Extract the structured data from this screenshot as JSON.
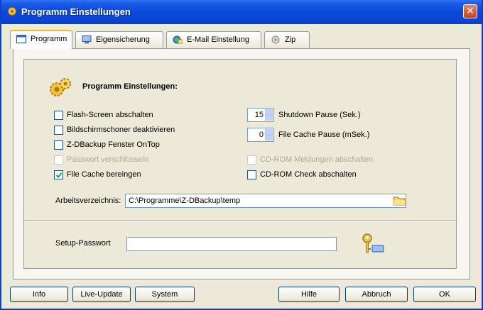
{
  "window": {
    "title": "Programm Einstellungen",
    "close_symbol": "✕"
  },
  "tabs": [
    {
      "label": "Programm",
      "icon": "window-icon"
    },
    {
      "label": "Eigensicherung",
      "icon": "monitor-icon"
    },
    {
      "label": "E-Mail Einstellung",
      "icon": "globe-mail-icon"
    },
    {
      "label": "Zip",
      "icon": "zip-icon"
    }
  ],
  "section": {
    "title": "Programm Einstellungen:"
  },
  "checkboxes_left": [
    {
      "label": "Flash-Screen abschalten",
      "checked": false,
      "enabled": true
    },
    {
      "label": "Bildschirmschoner deaktivieren",
      "checked": false,
      "enabled": true
    },
    {
      "label": "Z-DBackup Fenster OnTop",
      "checked": false,
      "enabled": true
    },
    {
      "label": "Passwort verschlüsseln",
      "checked": false,
      "enabled": false
    },
    {
      "label": "File Cache bereingen",
      "checked": true,
      "enabled": true
    }
  ],
  "spinners": [
    {
      "value": "15",
      "label": "Shutdown Pause (Sek.)"
    },
    {
      "value": "0",
      "label": "File Cache Pause (mSek.)"
    }
  ],
  "checkboxes_right": [
    {
      "label": "CD-ROM Meldungen abschalten",
      "checked": false,
      "enabled": false
    },
    {
      "label": "CD-ROM Check abschalten",
      "checked": false,
      "enabled": true
    }
  ],
  "workdir": {
    "label": "Arbeitsverzeichnis:",
    "value": "C:\\Programme\\Z-DBackup\\temp"
  },
  "password": {
    "label": "Setup-Passwort",
    "value": ""
  },
  "buttons": {
    "info": "Info",
    "live_update": "Live-Update",
    "system": "System",
    "help": "Hilfe",
    "cancel": "Abbruch",
    "ok": "OK"
  },
  "colors": {
    "accent": "#0b48d8",
    "tab_highlight": "#f1b73a",
    "check": "#21a121"
  }
}
